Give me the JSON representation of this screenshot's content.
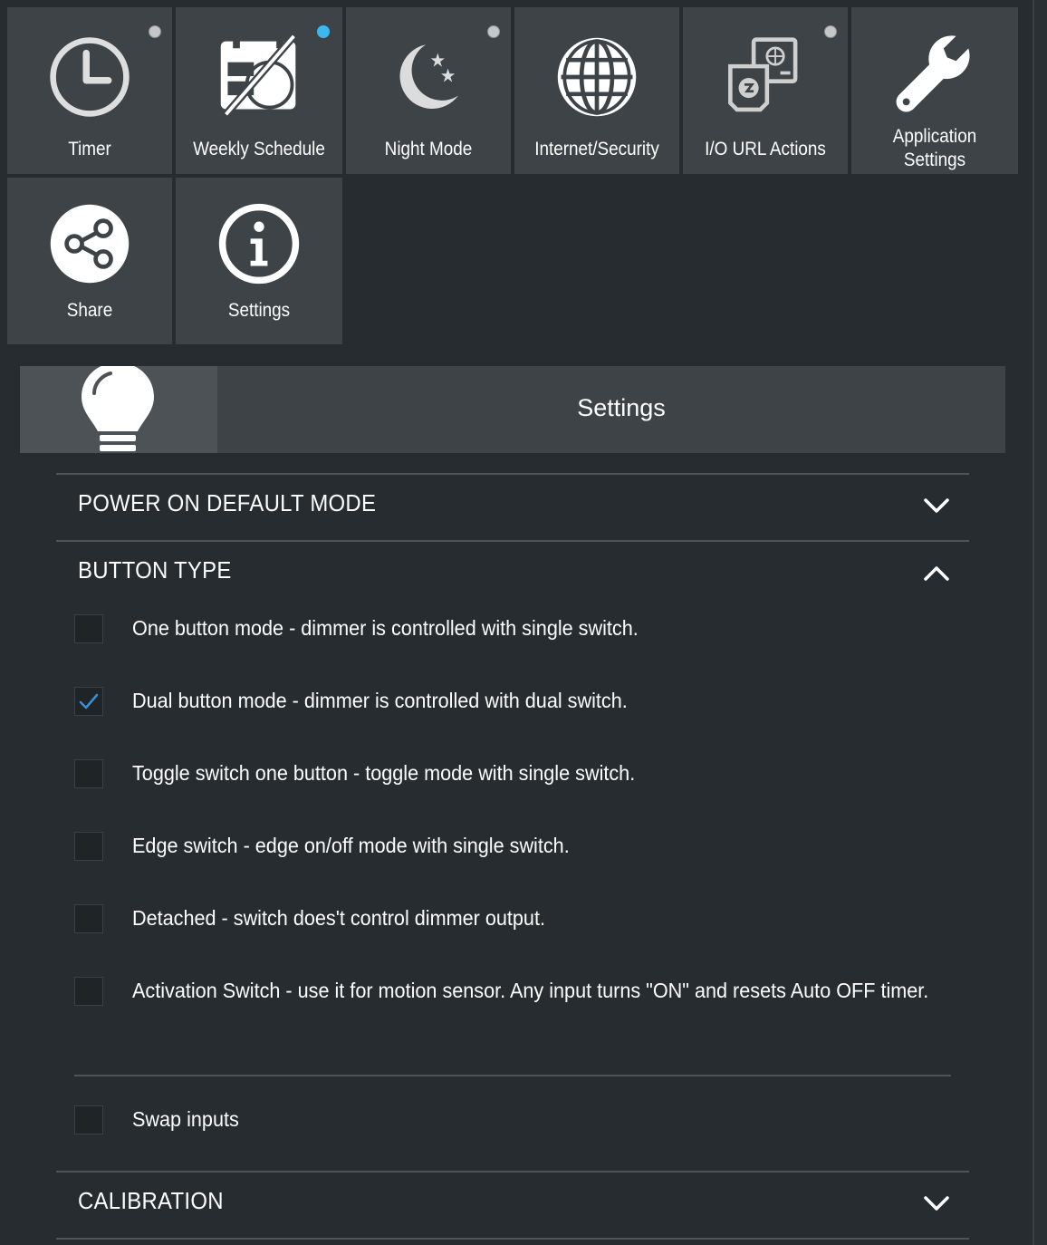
{
  "tiles": [
    {
      "label": "Timer",
      "icon": "clock-icon",
      "indicator": "inactive"
    },
    {
      "label": "Weekly Schedule",
      "icon": "weekly-schedule-icon",
      "indicator": "active"
    },
    {
      "label": "Night Mode",
      "icon": "moon-stars-icon",
      "indicator": "inactive"
    },
    {
      "label": "Internet/Security",
      "icon": "globe-icon",
      "indicator": "none"
    },
    {
      "label": "I/O URL Actions",
      "icon": "url-actions-icon",
      "indicator": "inactive"
    },
    {
      "label_line1": "Application",
      "label_line2": "Settings",
      "icon": "wrench-icon",
      "indicator": "none"
    },
    {
      "label": "Share",
      "icon": "share-icon",
      "indicator": "none"
    },
    {
      "label": "Settings",
      "icon": "info-icon",
      "indicator": "none"
    }
  ],
  "header": {
    "title": "Settings",
    "icon": "lightbulb-icon"
  },
  "sections": {
    "power_on": {
      "title": "POWER ON DEFAULT MODE",
      "expanded": false
    },
    "button_type": {
      "title": "BUTTON TYPE",
      "expanded": true,
      "options": [
        {
          "label": "One button mode - dimmer is controlled with single switch.",
          "checked": false
        },
        {
          "label": "Dual button mode - dimmer is controlled with dual switch.",
          "checked": true
        },
        {
          "label": "Toggle switch one button - toggle mode with single switch.",
          "checked": false
        },
        {
          "label": "Edge switch - edge on/off mode with single switch.",
          "checked": false
        },
        {
          "label": "Detached - switch does't control dimmer output.",
          "checked": false
        },
        {
          "label": "Activation Switch - use it for motion sensor. Any input turns \"ON\" and resets Auto OFF timer.",
          "checked": false
        }
      ],
      "swap_inputs": {
        "label": "Swap inputs",
        "checked": false
      }
    },
    "calibration": {
      "title": "CALIBRATION",
      "expanded": false
    }
  },
  "colors": {
    "background": "#262c30",
    "tile": "#3d4347",
    "accent": "#3ab8f0",
    "checkmark": "#3a8fd8"
  }
}
